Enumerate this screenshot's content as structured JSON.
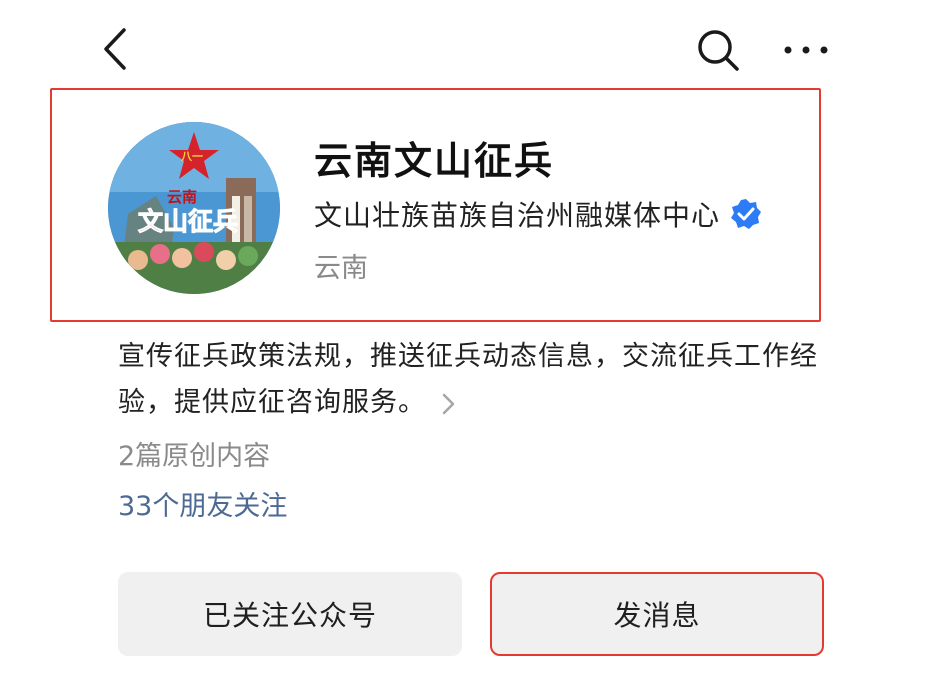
{
  "account": {
    "name": "云南文山征兵",
    "org": "文山壮族苗族自治州融媒体中心",
    "region": "云南",
    "avatar_text_small": "云南",
    "avatar_text_big": "文山征兵"
  },
  "description": "宣传征兵政策法规，推送征兵动态信息，交流征兵工作经验，提供应征咨询服务。",
  "stats": {
    "original_count": "2篇原创内容",
    "friends_following": "33个朋友关注"
  },
  "buttons": {
    "follow_label": "已关注公众号",
    "message_label": "发消息"
  },
  "colors": {
    "highlight_border": "#e33b32",
    "verified_blue": "#2d7cf6",
    "friends_link": "#4c6a93"
  },
  "icons": {
    "back": "chevron-left-icon",
    "search": "search-icon",
    "more": "more-dots-icon",
    "verified": "verified-badge-icon",
    "description_more": "chevron-right-icon"
  }
}
